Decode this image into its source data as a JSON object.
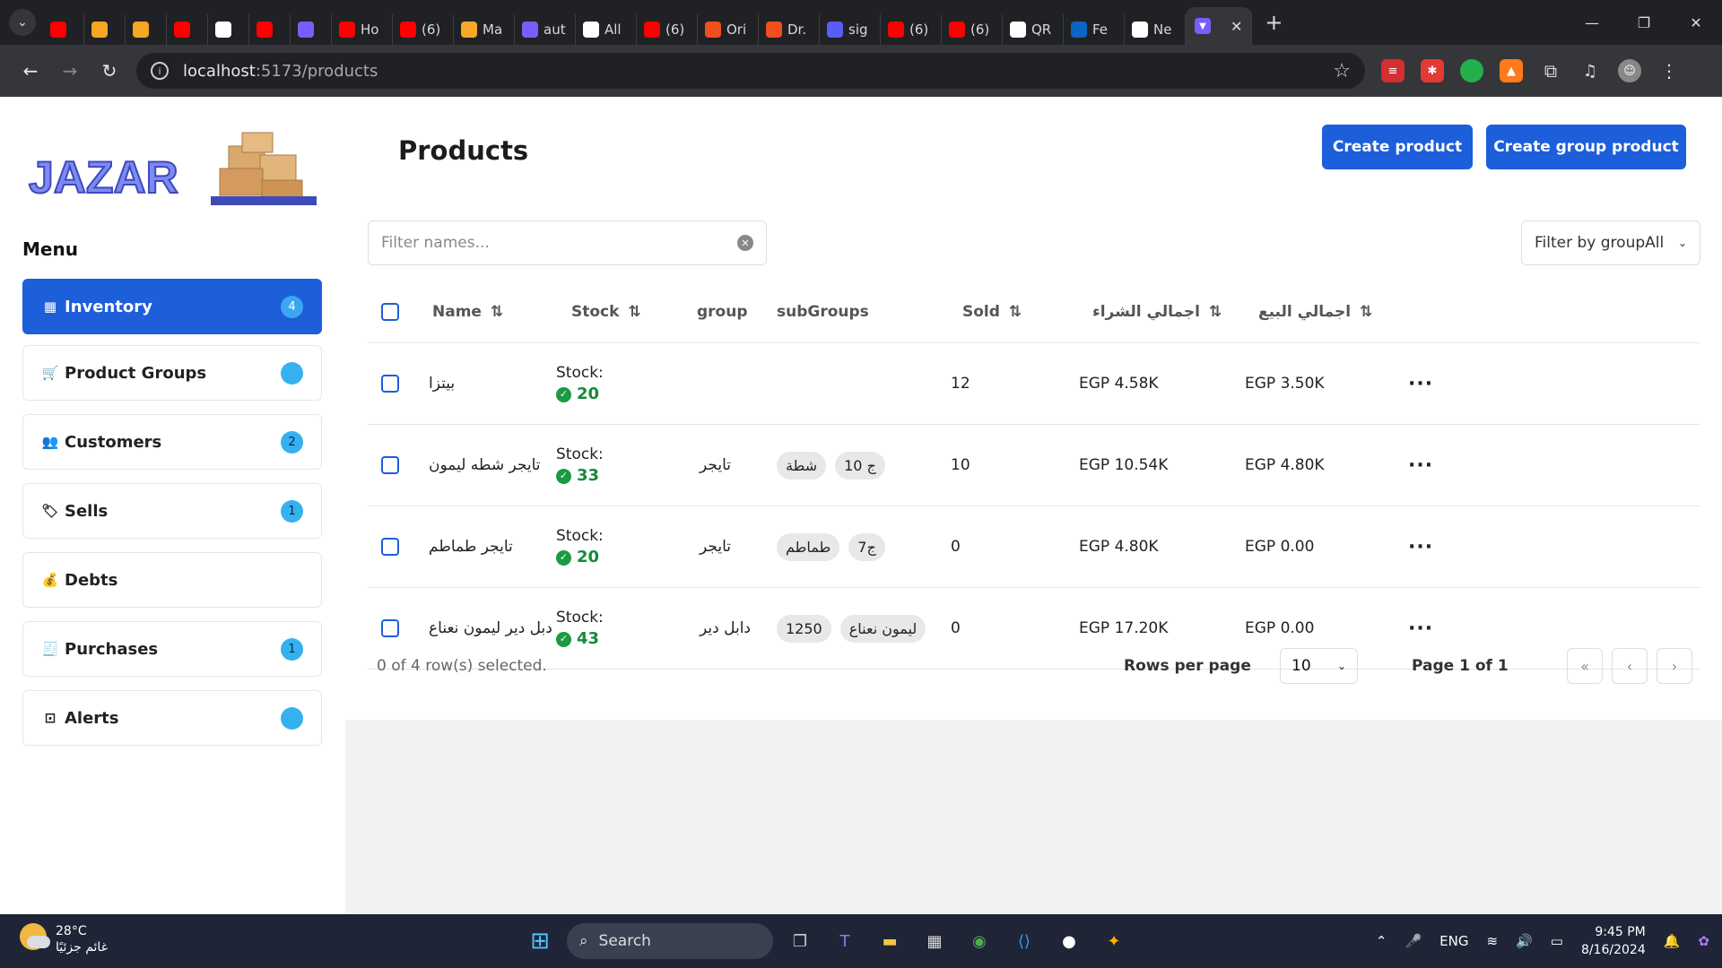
{
  "browser": {
    "tabs": [
      {
        "label": "",
        "color": "#ff0000"
      },
      {
        "label": "",
        "color": "#f5a623"
      },
      {
        "label": "",
        "color": "#f5a623"
      },
      {
        "label": "",
        "color": "#ff0000"
      },
      {
        "label": "",
        "color": "#ffffff"
      },
      {
        "label": "",
        "color": "#ff0000"
      },
      {
        "label": "",
        "color": "#7b5cff"
      },
      {
        "label": "Ho",
        "color": "#ff0000"
      },
      {
        "label": "(6)",
        "color": "#ff0000"
      },
      {
        "label": "Ma",
        "color": "#f7a72a"
      },
      {
        "label": "aut",
        "color": "#7b5cff"
      },
      {
        "label": "All",
        "color": "#ffffff"
      },
      {
        "label": "(6)",
        "color": "#ff0000"
      },
      {
        "label": "Ori",
        "color": "#f24e1e"
      },
      {
        "label": "Dr.",
        "color": "#f24e1e"
      },
      {
        "label": "sig",
        "color": "#5b5bf5"
      },
      {
        "label": "(6)",
        "color": "#ff0000"
      },
      {
        "label": "(6)",
        "color": "#ff0000"
      },
      {
        "label": "QR",
        "color": "#ffffff"
      },
      {
        "label": "Fe",
        "color": "#0a66c2"
      },
      {
        "label": "Ne",
        "color": "#ffffff"
      }
    ],
    "url_host": "localhost",
    "url_path": ":5173/products"
  },
  "sidebar": {
    "logo_text": "JAZAR",
    "menu_title": "Menu",
    "items": [
      {
        "label": "Inventory",
        "badge": "4"
      },
      {
        "label": "Product Groups",
        "badge": ""
      },
      {
        "label": "Customers",
        "badge": "2"
      },
      {
        "label": "Sells",
        "badge": "1"
      },
      {
        "label": "Debts",
        "badge": ""
      },
      {
        "label": "Purchases",
        "badge": "1"
      },
      {
        "label": "Alerts",
        "badge": ""
      }
    ]
  },
  "main": {
    "title": "Products",
    "create_product": "Create product",
    "create_group_product": "Create group product",
    "filter_placeholder": "Filter names...",
    "group_filter": "Filter by groupAll",
    "columns": {
      "name": "Name",
      "stock": "Stock",
      "group": "group",
      "subgroups": "subGroups",
      "sold": "Sold",
      "total_purchase": "اجمالي الشراء",
      "total_sale": "اجمالي البيع"
    },
    "stock_label": "Stock:",
    "rows": [
      {
        "name": "بيتزا",
        "stock": "20",
        "group": "",
        "subgroups": [],
        "sold": "12",
        "purchase": "EGP 4.58K",
        "sale": "EGP 3.50K"
      },
      {
        "name": "تايجر شطه ليمون",
        "stock": "33",
        "group": "تايجر",
        "subgroups": [
          "شطة",
          "ج 10"
        ],
        "sold": "10",
        "purchase": "EGP 10.54K",
        "sale": "EGP 4.80K"
      },
      {
        "name": "تايجر طماطم",
        "stock": "20",
        "group": "تايجر",
        "subgroups": [
          "طماطم",
          "7ج"
        ],
        "sold": "0",
        "purchase": "EGP 4.80K",
        "sale": "EGP 0.00"
      },
      {
        "name": "دبل دير ليمون نعناع",
        "stock": "43",
        "group": "دابل دير",
        "subgroups": [
          "1250",
          "ليمون نعناع"
        ],
        "sold": "0",
        "purchase": "EGP 17.20K",
        "sale": "EGP 0.00"
      }
    ],
    "selection_text": "0 of 4 row(s) selected.",
    "rows_per_page_label": "Rows per page",
    "rows_per_page": "10",
    "page_label": "Page 1 of 1"
  },
  "taskbar": {
    "temperature": "28°C",
    "weather_text": "غائم جزئيًا",
    "search": "Search",
    "language": "ENG",
    "time": "9:45 PM",
    "date": "8/16/2024"
  }
}
